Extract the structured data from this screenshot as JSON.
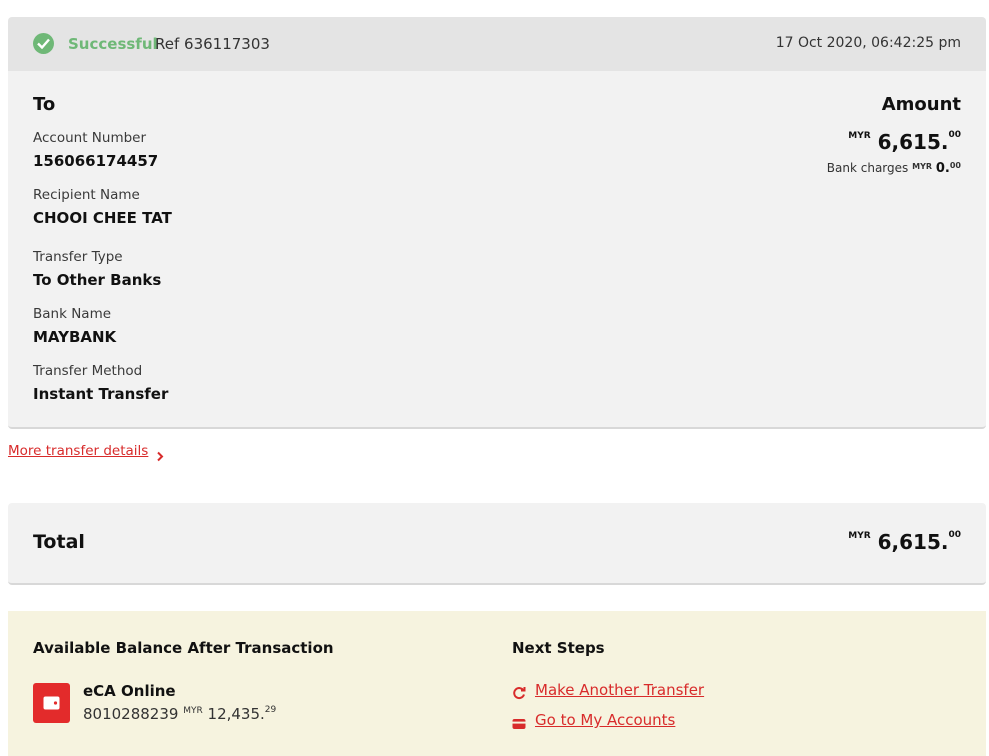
{
  "status": {
    "state": "Successful",
    "ref": "Ref 636117303",
    "timestamp": "17 Oct 2020, 06:42:25 pm",
    "accent_color": "#6fb877"
  },
  "details": {
    "to_title": "To",
    "amount_title": "Amount",
    "fields": [
      {
        "label": "Account Number",
        "value": "156066174457"
      },
      {
        "label": "Recipient Name",
        "value": "CHOOI CHEE TAT"
      },
      {
        "label": "Transfer Type",
        "value": "To Other Banks"
      },
      {
        "label": "Bank Name",
        "value": "MAYBANK"
      },
      {
        "label": "Transfer Method",
        "value": "Instant Transfer"
      }
    ],
    "amount": {
      "currency": "MYR",
      "whole": "6,615.",
      "cents": "00"
    },
    "bank_charges": {
      "label": "Bank charges",
      "currency": "MYR",
      "whole": "0.",
      "cents": "00"
    }
  },
  "more_link": "More transfer details",
  "total": {
    "label": "Total",
    "currency": "MYR",
    "whole": "6,615.",
    "cents": "00"
  },
  "balance": {
    "title": "Available Balance After Transaction",
    "account_name": "eCA Online",
    "account_number": "8010288239",
    "currency": "MYR",
    "whole": "12,435.",
    "cents": "29",
    "icon": "wallet-icon"
  },
  "next_steps": {
    "title": "Next Steps",
    "links": [
      {
        "label": "Make Another Transfer",
        "icon": "refresh-icon"
      },
      {
        "label": "Go to My Accounts",
        "icon": "card-icon"
      }
    ],
    "link_color": "#d82b2b"
  }
}
